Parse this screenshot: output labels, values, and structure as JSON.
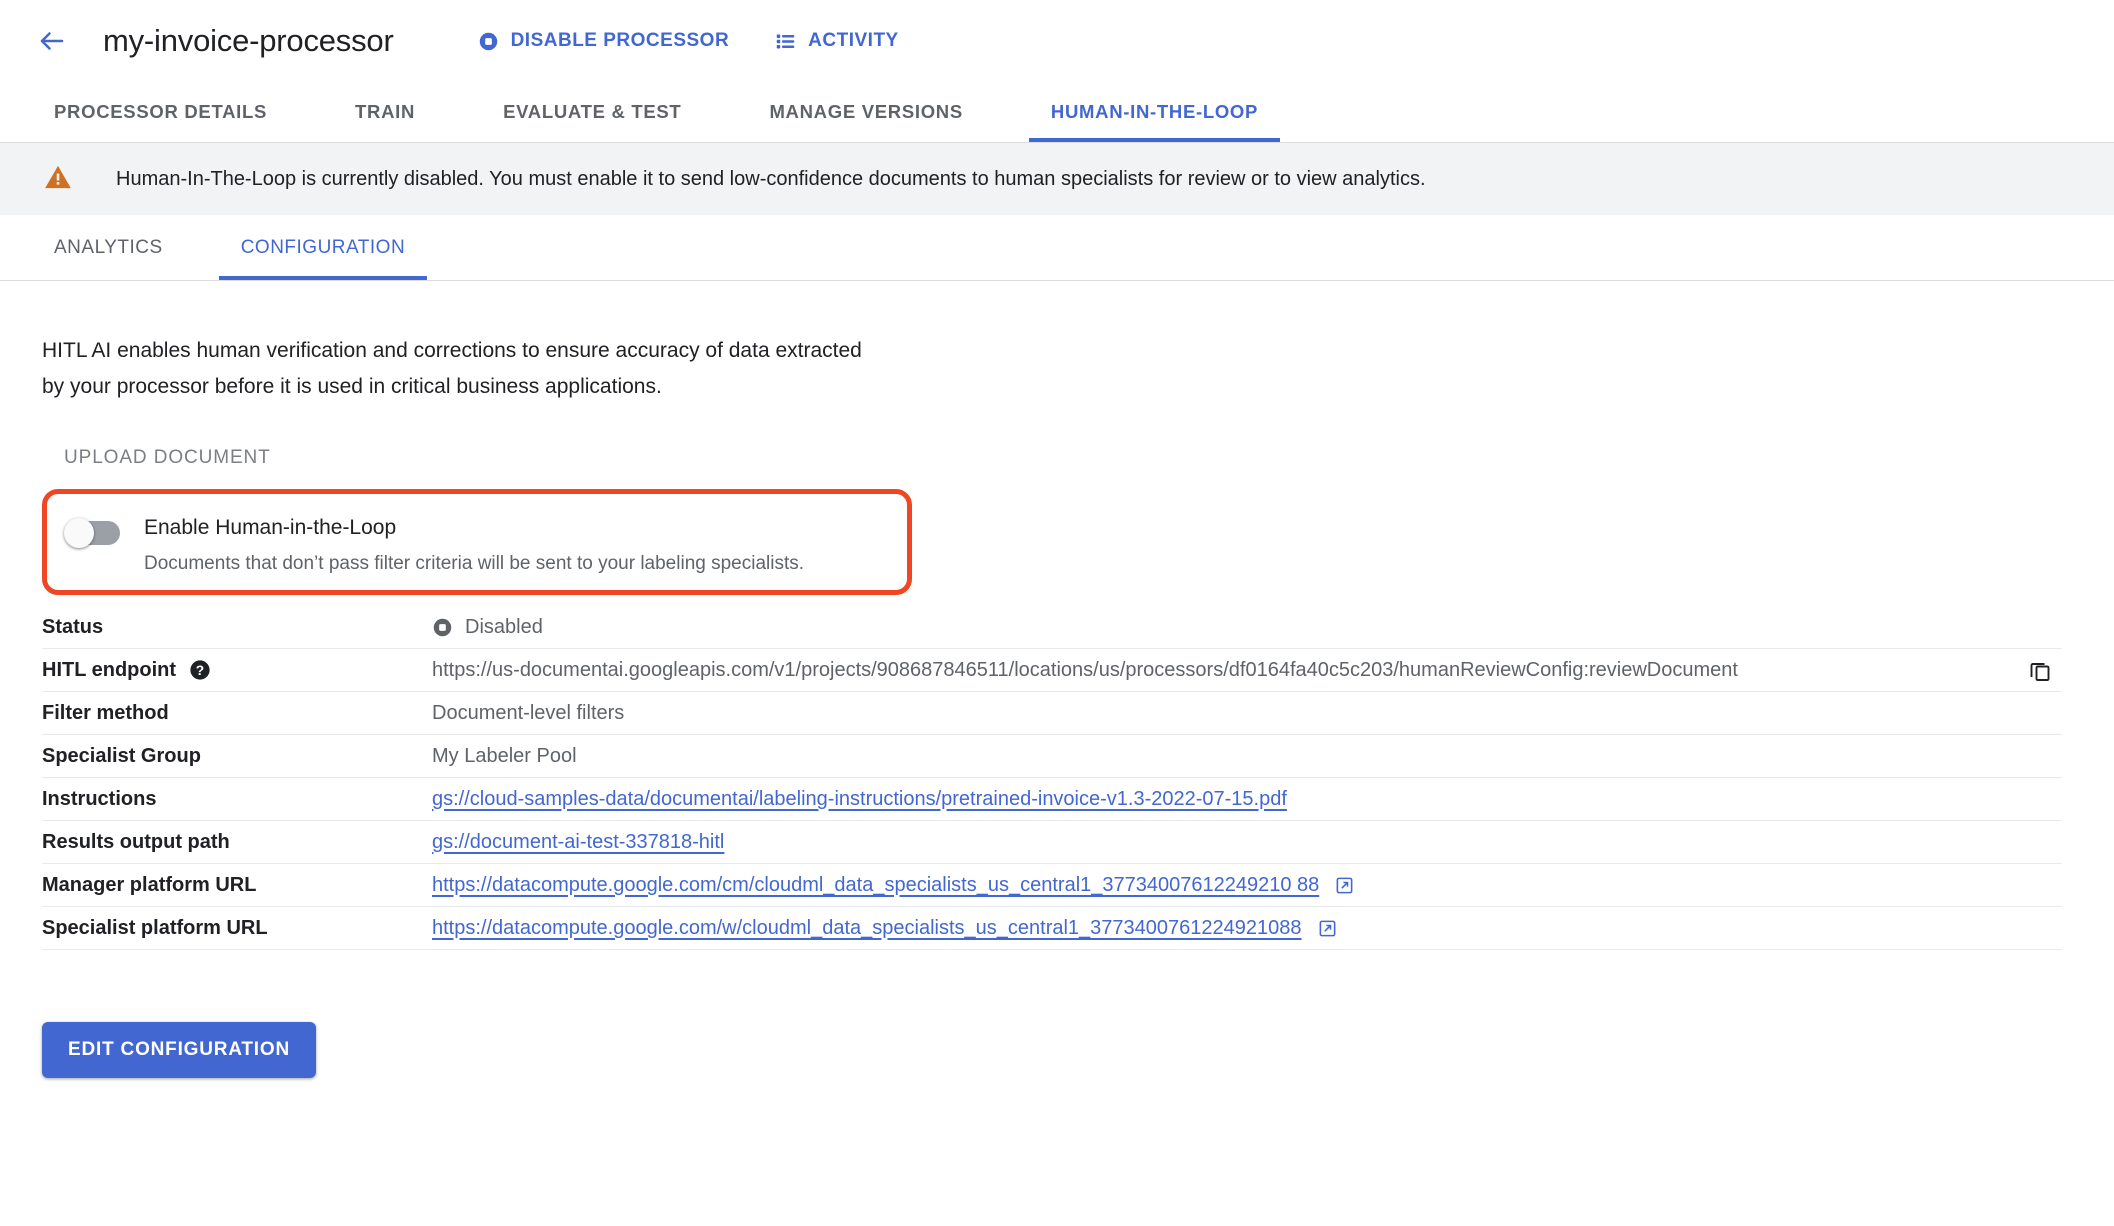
{
  "header": {
    "back_icon": "arrow-left-icon",
    "title": "my-invoice-processor",
    "actions": [
      {
        "label": "DISABLE PROCESSOR",
        "icon": "stop-circle-icon"
      },
      {
        "label": "ACTIVITY",
        "icon": "list-icon"
      }
    ]
  },
  "tabs": [
    {
      "label": "PROCESSOR DETAILS",
      "active": false
    },
    {
      "label": "TRAIN",
      "active": false
    },
    {
      "label": "EVALUATE & TEST",
      "active": false
    },
    {
      "label": "MANAGE VERSIONS",
      "active": false
    },
    {
      "label": "HUMAN-IN-THE-LOOP",
      "active": true
    }
  ],
  "banner": {
    "icon": "warning-triangle-icon",
    "text": "Human-In-The-Loop is currently disabled. You must enable it to send low-confidence documents to human specialists for review or to view analytics."
  },
  "subtabs": [
    {
      "label": "ANALYTICS",
      "active": false
    },
    {
      "label": "CONFIGURATION",
      "active": true
    }
  ],
  "main": {
    "intro_line1": "HITL AI enables human verification and corrections to ensure accuracy of data extracted",
    "intro_line2": "by your processor before it is used in critical business applications.",
    "upload_document_label": "UPLOAD DOCUMENT",
    "toggle": {
      "title": "Enable Human-in-the-Loop",
      "subtitle": "Documents that don’t pass filter criteria will be sent to your labeling specialists.",
      "enabled": false,
      "highlight_color": "#ef4623"
    },
    "details": [
      {
        "label": "Status",
        "value": "Disabled",
        "type": "status",
        "icon": "stop-circle-icon"
      },
      {
        "label": "HITL endpoint",
        "value": "https://us-documentai.googleapis.com/v1/projects/908687846511/locations/us/processors/df0164fa40c5c203/humanReviewConfig:reviewDocument",
        "type": "text",
        "help_icon": "help-icon",
        "copy_icon": "copy-icon"
      },
      {
        "label": "Filter method",
        "value": "Document-level filters",
        "type": "text"
      },
      {
        "label": "Specialist Group",
        "value": "My Labeler Pool",
        "type": "text"
      },
      {
        "label": "Instructions",
        "value": "gs://cloud-samples-data/documentai/labeling-instructions/pretrained-invoice-v1.3-2022-07-15.pdf",
        "type": "link"
      },
      {
        "label": "Results output path",
        "value": "gs://document-ai-test-337818-hitl",
        "type": "link"
      },
      {
        "label": "Manager platform URL",
        "value": "https://datacompute.google.com/cm/cloudml_data_specialists_us_central1_37734007612249210 88",
        "type": "link-external",
        "external_icon": "external-link-icon"
      },
      {
        "label": "Specialist platform URL",
        "value": "https://datacompute.google.com/w/cloudml_data_specialists_us_central1_3773400761224921088",
        "type": "link-external",
        "external_icon": "external-link-icon"
      }
    ],
    "edit_button_label": "EDIT CONFIGURATION"
  },
  "colors": {
    "accent_blue": "#4267d0",
    "warning_orange": "#e07b26",
    "highlight_red": "#ef4623",
    "text_primary": "#202124",
    "text_secondary": "#5f6368"
  }
}
